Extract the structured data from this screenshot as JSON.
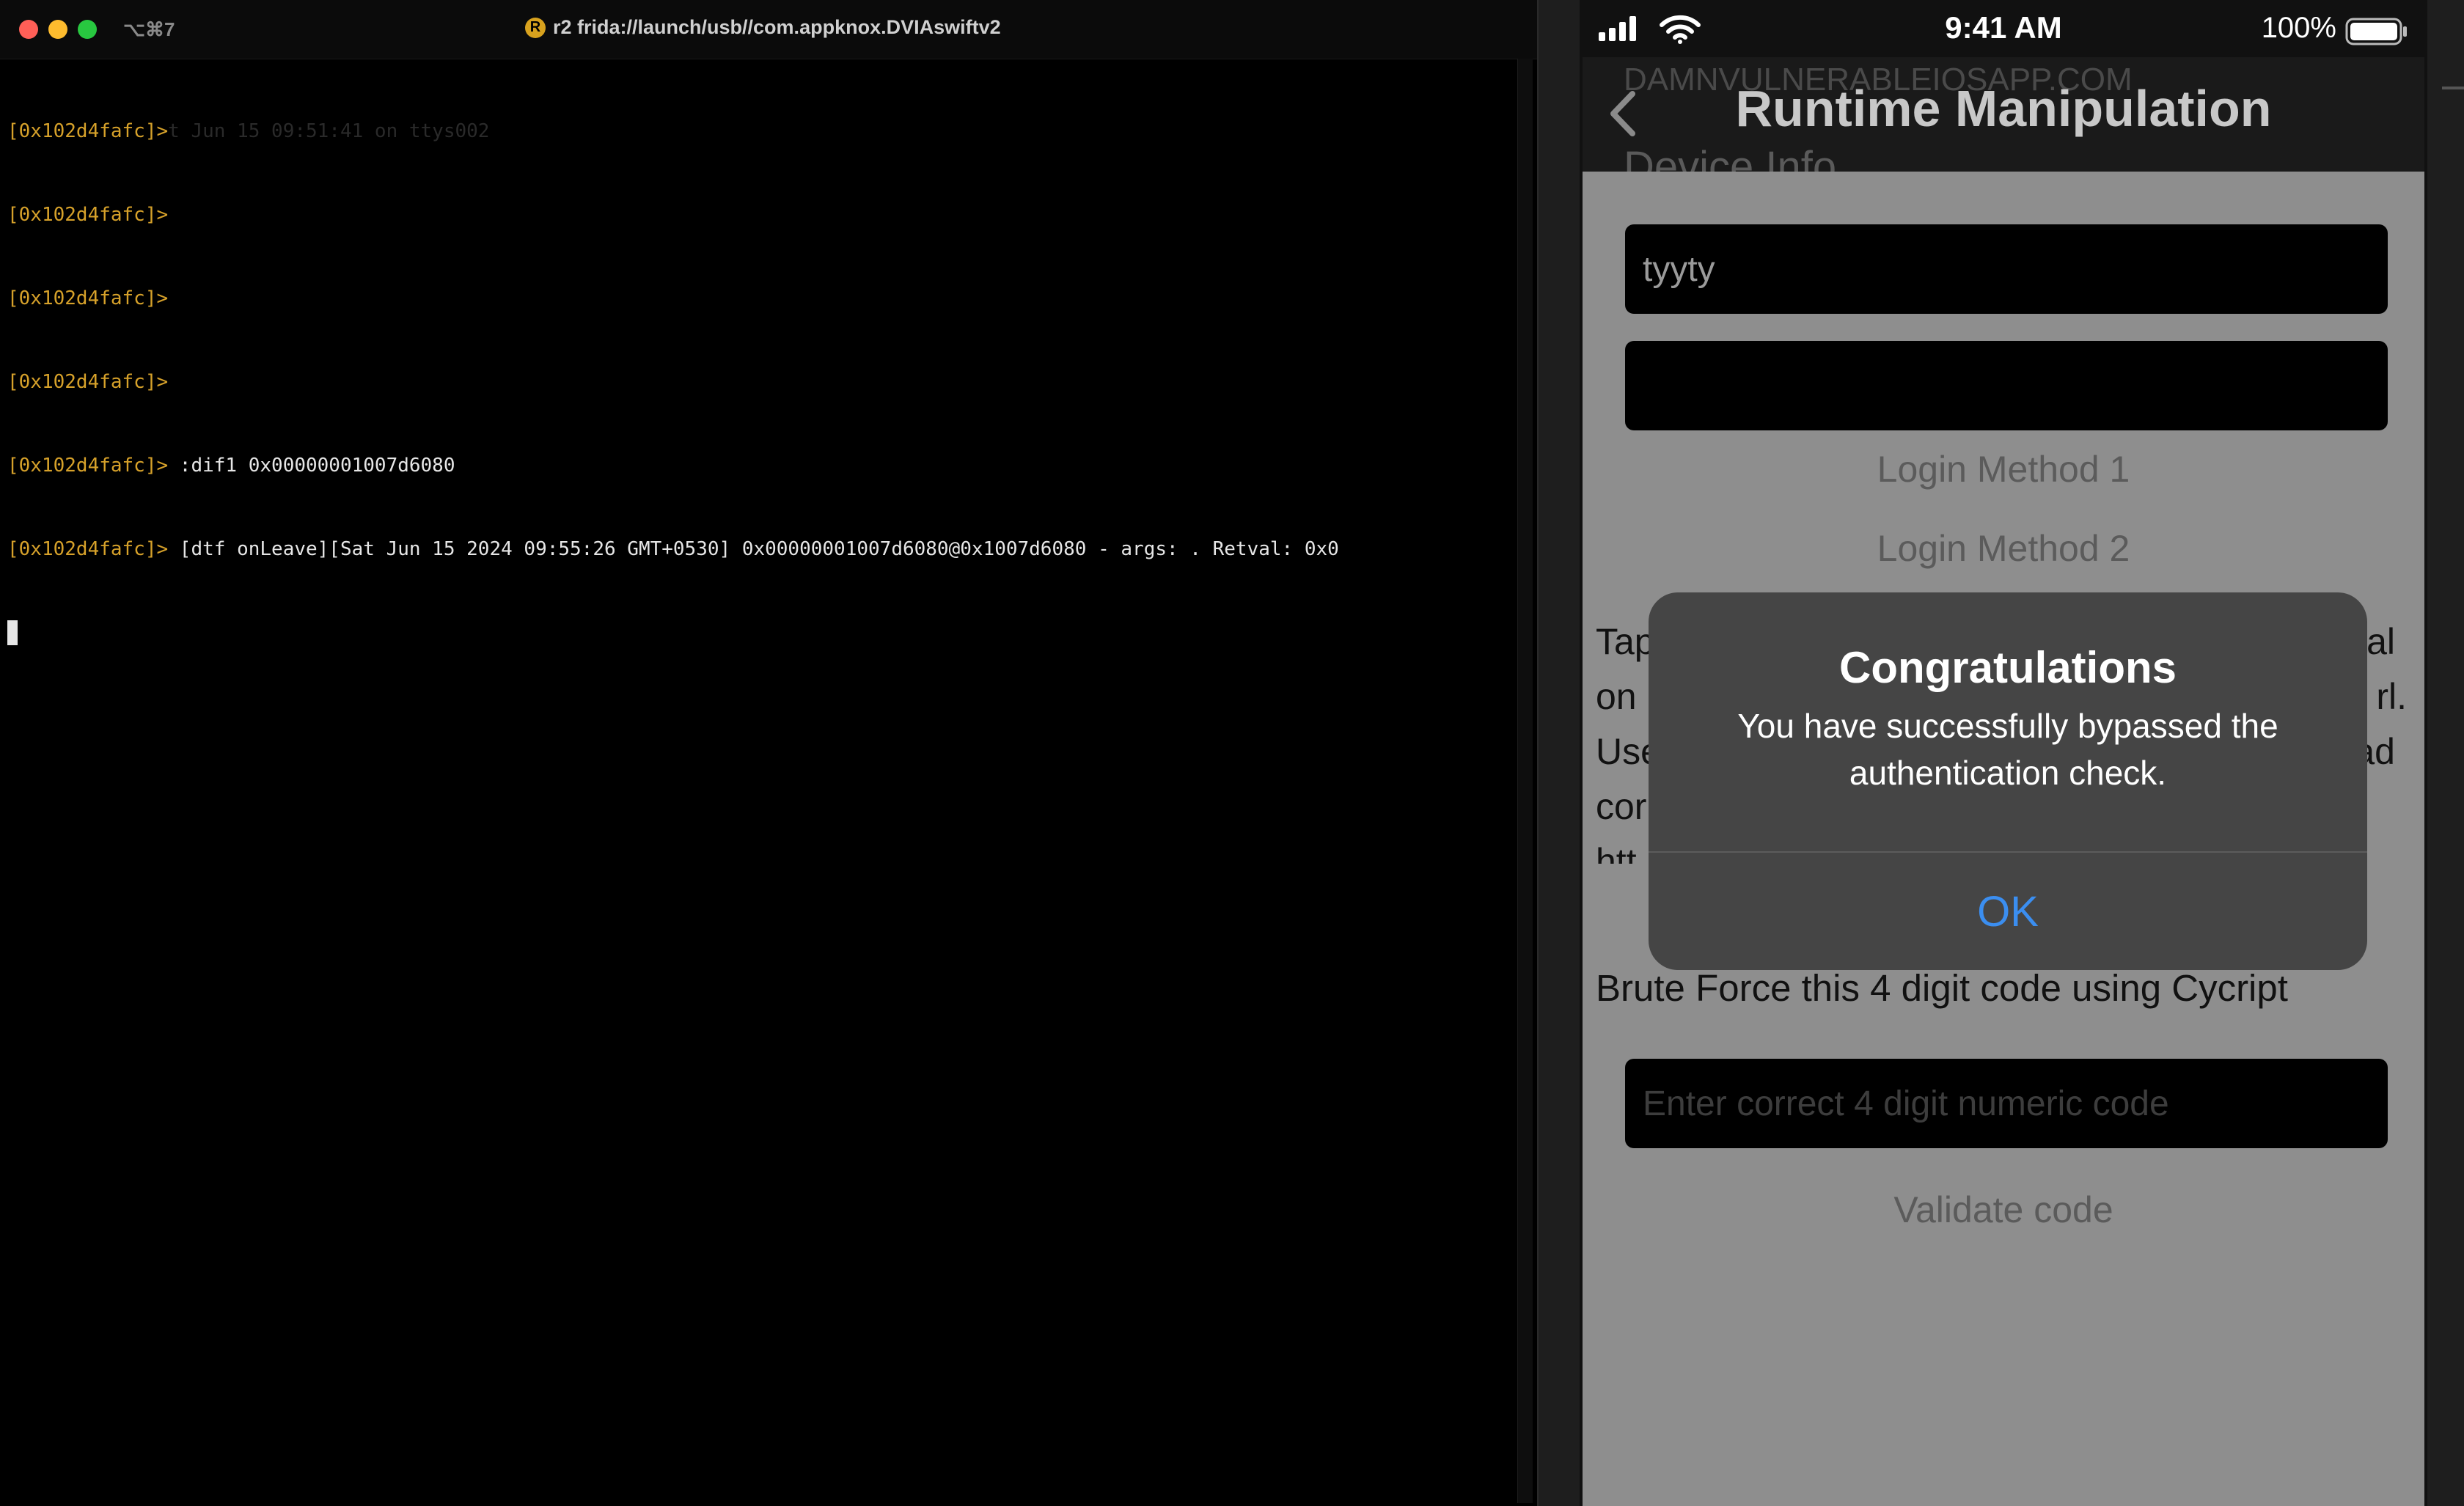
{
  "terminal": {
    "shortcut": "⌥⌘7",
    "title": "r2 frida://launch/usb//com.appknox.DVIAswiftv2",
    "icon_letter": "R",
    "lines": [
      {
        "prompt": "[0x102d4fafc]>",
        "text": "",
        "ghost": "t Jun 15 09:51:41 on ttys002"
      },
      {
        "prompt": "[0x102d4fafc]>",
        "text": "",
        "ghost": ""
      },
      {
        "prompt": "[0x102d4fafc]>",
        "text": "",
        "ghost": ""
      },
      {
        "prompt": "[0x102d4fafc]>",
        "text": "",
        "ghost": ""
      },
      {
        "prompt": "[0x102d4fafc]>",
        "text": " :dif1 0x00000001007d6080",
        "ghost": ""
      },
      {
        "prompt": "[0x102d4fafc]>",
        "text": " [dtf onLeave][Sat Jun 15 2024 09:55:26 GMT+0530] 0x00000001007d6080@0x1007d6080 - args: . Retval: 0x0",
        "ghost": ""
      }
    ]
  },
  "phone": {
    "status": {
      "time": "9:41 AM",
      "battery": "100%"
    },
    "nav": {
      "watermark": "DAMNVULNERABLEIOSAPP.COM",
      "title": "Runtime Manipulation",
      "subtitle": "Device Info"
    },
    "username_value": "tyyty",
    "password_value": "",
    "login_method_1": "Login Method 1",
    "login_method_2": "Login Method 2",
    "info_lines": [
      "Tap",
      "on",
      "Use",
      "cor",
      "htt"
    ],
    "info_lines_right": [
      "al",
      "rl.",
      "ad",
      "",
      ""
    ],
    "brute_text": "Brute Force this 4 digit code using Cycript",
    "code_placeholder": "Enter correct 4 digit numeric code",
    "validate_label": "Validate code",
    "alert": {
      "title": "Congratulations",
      "message": "You have successfully bypassed the authentication check.",
      "ok_label": "OK"
    }
  }
}
